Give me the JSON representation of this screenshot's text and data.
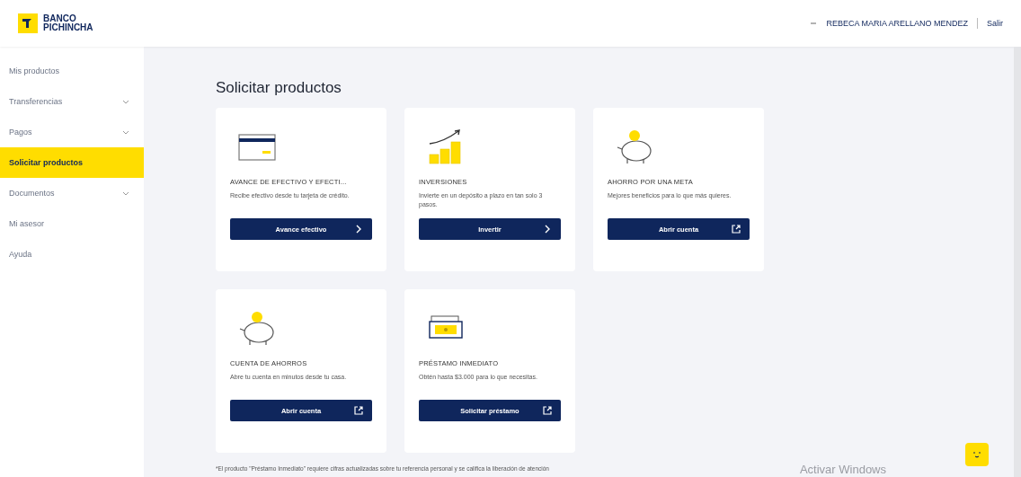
{
  "header": {
    "logo": {
      "line1": "BANCO",
      "line2": "PICHINCHA"
    },
    "user_name": "REBECA MARIA ARELLANO MENDEZ",
    "logout": "Salir"
  },
  "sidebar": {
    "items": [
      {
        "label": "Mis productos",
        "selected": false,
        "expandable": false
      },
      {
        "label": "Transferencias",
        "selected": false,
        "expandable": true
      },
      {
        "label": "Pagos",
        "selected": false,
        "expandable": true
      },
      {
        "label": "Solicitar productos",
        "selected": true,
        "expandable": false
      },
      {
        "label": "Documentos",
        "selected": false,
        "expandable": true
      },
      {
        "label": "Mi asesor",
        "selected": false,
        "expandable": false
      },
      {
        "label": "Ayuda",
        "selected": false,
        "expandable": false
      }
    ]
  },
  "page_title": "Solicitar productos",
  "cards": [
    {
      "kind": "card",
      "title": "AVANCE DE EFECTIVO Y EFECTI...",
      "description": "Recibe efectivo desde tu tarjeta de crédito.",
      "button": {
        "label": "Avance efectivo",
        "kind": "next"
      }
    },
    {
      "kind": "growth",
      "title": "INVERSIONES",
      "description": "Invierte en un depósito a plazo en tan solo 3 pasos.",
      "button": {
        "label": "Invertir",
        "kind": "next"
      }
    },
    {
      "kind": "piggy",
      "title": "AHORRO POR UNA META",
      "description": "Mejores beneficios para lo que más quieres.",
      "button": {
        "label": "Abrir cuenta",
        "kind": "external"
      }
    },
    {
      "kind": "piggy",
      "title": "CUENTA DE AHORROS",
      "description": "Abre tu cuenta en minutos desde tu casa.",
      "button": {
        "label": "Abrir cuenta",
        "kind": "external"
      }
    },
    {
      "kind": "money",
      "title": "PRÉSTAMO INMEDIATO",
      "description": "Obtén hasta $3.000 para lo que necesitas.",
      "button": {
        "label": "Solicitar préstamo",
        "kind": "external"
      }
    }
  ],
  "footnote": "*El producto \"Préstamo Inmediato\" requiere cifras actualizadas sobre tu referencia personal y se califica la liberación de atención",
  "os_overlay": "Activar Windows"
}
